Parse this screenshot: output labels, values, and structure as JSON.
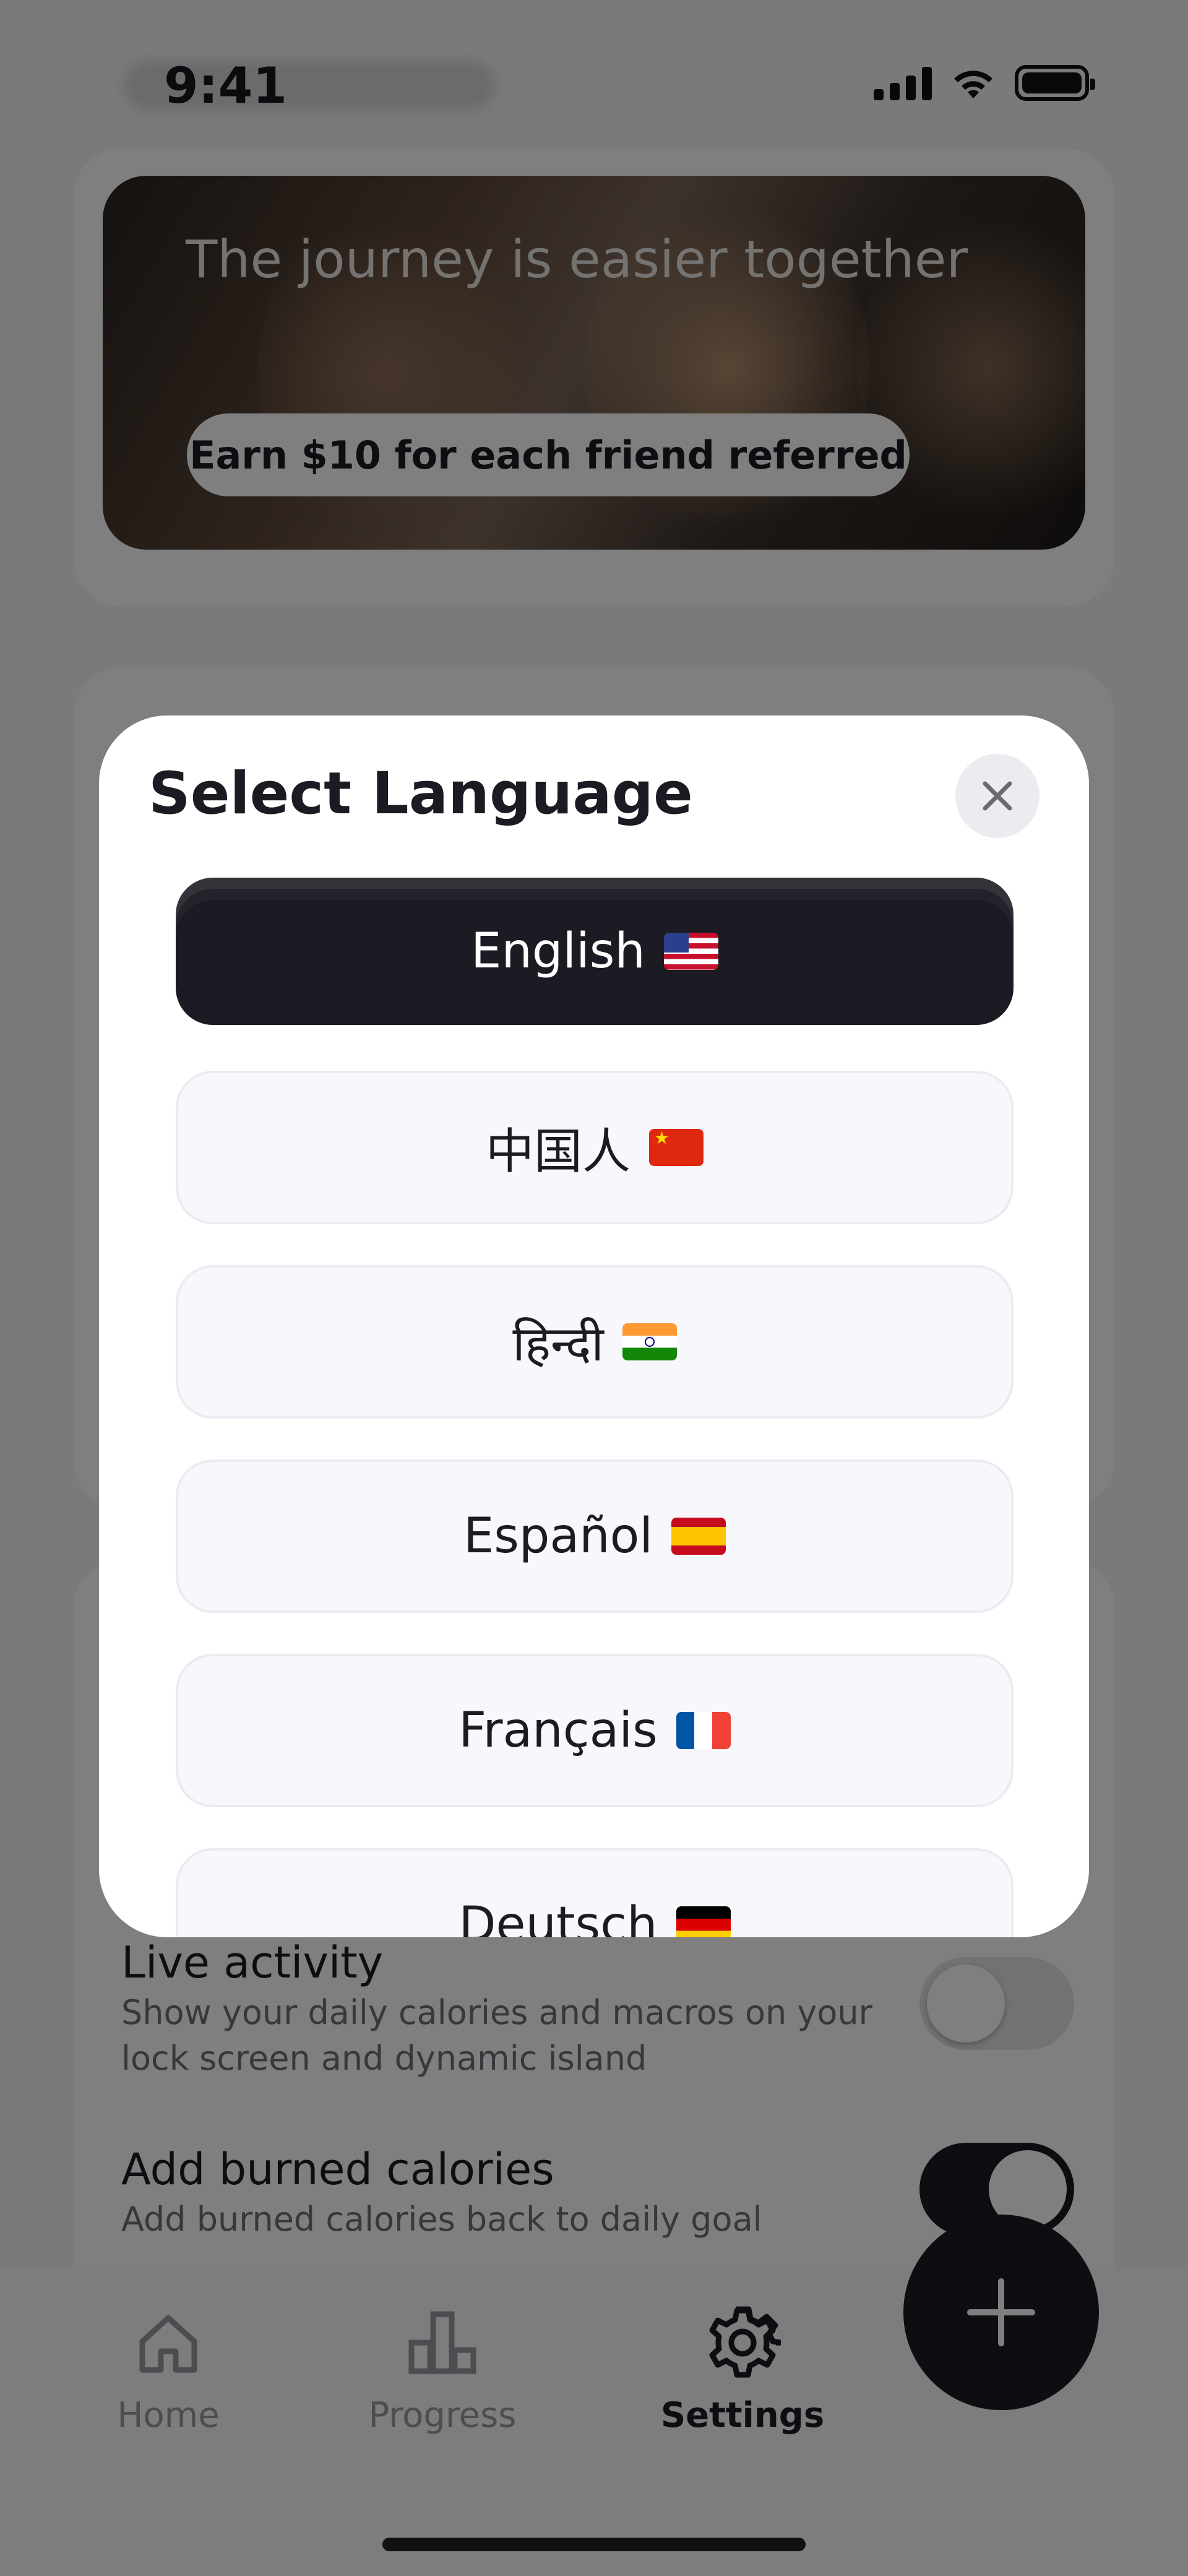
{
  "status_bar": {
    "time": "9:41"
  },
  "referral": {
    "title": "The journey is easier together",
    "cta": "Earn $10 for each friend referred"
  },
  "settings": {
    "live_activity": {
      "title": "Live activity",
      "subtitle_line1": "Show your daily calories and macros on your",
      "subtitle_line2": "lock screen and dynamic island",
      "enabled": false
    },
    "burned_calories": {
      "title": "Add burned calories",
      "subtitle": "Add burned calories back to daily goal",
      "enabled": true
    }
  },
  "tabs": [
    {
      "label": "Home",
      "icon": "home-icon",
      "active": false
    },
    {
      "label": "Progress",
      "icon": "bar-chart-icon",
      "active": false
    },
    {
      "label": "Settings",
      "icon": "gear-icon",
      "active": true
    }
  ],
  "fab": {
    "icon": "plus-icon"
  },
  "modal": {
    "title": "Select Language",
    "close_icon": "close-icon",
    "languages": [
      {
        "label": "English",
        "flag": "us-flag-icon",
        "selected": true
      },
      {
        "label": "中国人",
        "flag": "china-flag-icon",
        "selected": false
      },
      {
        "label": "हिन्दी",
        "flag": "india-flag-icon",
        "selected": false
      },
      {
        "label": "Español",
        "flag": "spain-flag-icon",
        "selected": false
      },
      {
        "label": "Français",
        "flag": "france-flag-icon",
        "selected": false
      },
      {
        "label": "Deutsch",
        "flag": "germany-flag-icon",
        "selected": false
      }
    ]
  },
  "colors": {
    "accent_dark": "#1c1a22",
    "overlay": "rgba(0,0,0,0.5)",
    "option_bg": "#f8f7fb"
  }
}
